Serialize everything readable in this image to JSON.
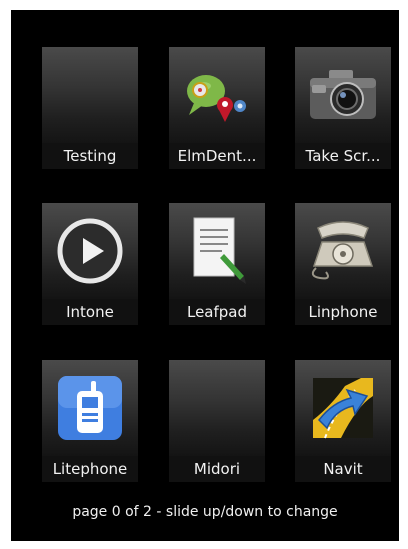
{
  "launcher": {
    "apps": [
      {
        "label": "Testing",
        "icon": "blank-icon"
      },
      {
        "label": "ElmDent...",
        "icon": "chat-pins-icon"
      },
      {
        "label": "Take Scr...",
        "icon": "camera-icon"
      },
      {
        "label": "Intone",
        "icon": "play-icon"
      },
      {
        "label": "Leafpad",
        "icon": "notepad-icon"
      },
      {
        "label": "Linphone",
        "icon": "telephone-icon"
      },
      {
        "label": "Litephone",
        "icon": "mobile-phone-icon"
      },
      {
        "label": "Midori",
        "icon": "blank-icon"
      },
      {
        "label": "Navit",
        "icon": "navigation-arrow-icon"
      }
    ],
    "footer": "page 0 of 2 - slide up/down to change"
  }
}
